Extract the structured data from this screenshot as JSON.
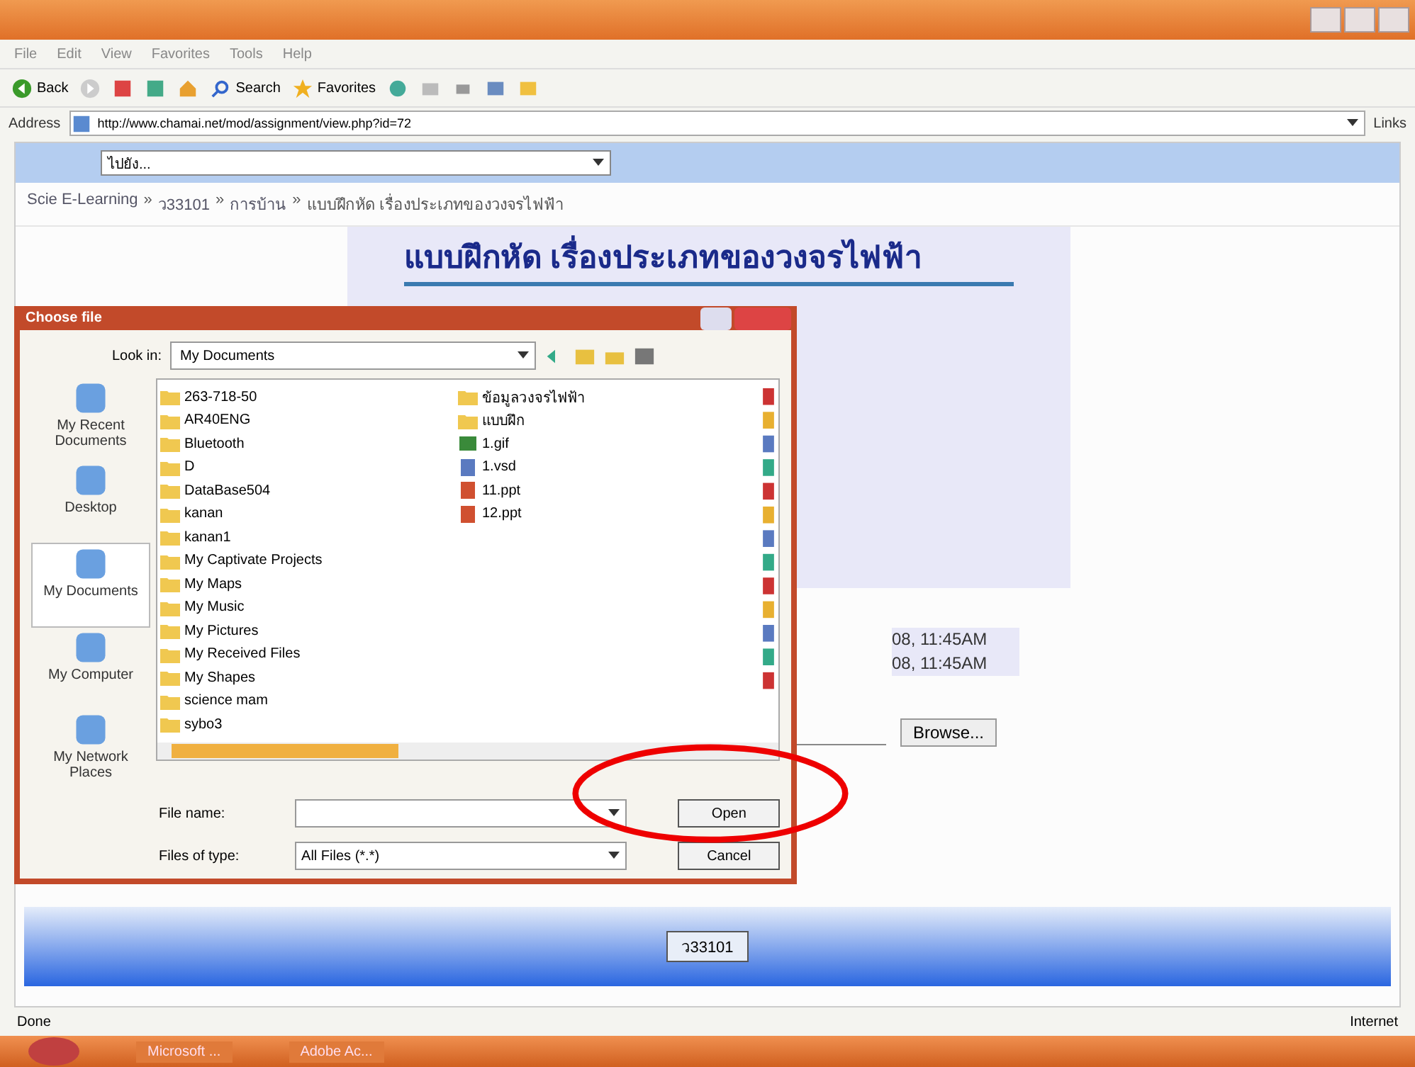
{
  "menu": [
    "File",
    "Edit",
    "View",
    "Favorites",
    "Tools",
    "Help"
  ],
  "toolbar": {
    "back": "Back",
    "search": "Search",
    "favorites": "Favorites"
  },
  "address": {
    "label": "Address",
    "url": "http://www.chamai.net/mod/assignment/view.php?id=72",
    "links": "Links"
  },
  "nav": {
    "jump": "ไปยัง..."
  },
  "breadcrumb": {
    "separator": "»",
    "items": [
      "Scie E-Learning",
      "ว33101",
      "การบ้าน",
      "แบบฝึกหัด เรื่องประเภทของวงจรไฟฟ้า"
    ]
  },
  "page": {
    "title": "แบบฝึกหัด เรื่องประเภทของวงจรไฟฟ้า",
    "dates": [
      "08, 11:45AM",
      "08, 11:45AM"
    ],
    "browse": "Browse..."
  },
  "footer": {
    "course_button": "ว33101"
  },
  "dialog": {
    "title": "Choose file",
    "look_in_label": "Look in:",
    "look_in": "My Documents",
    "places": [
      {
        "label": "My Recent Documents",
        "selected": false
      },
      {
        "label": "Desktop",
        "selected": false
      },
      {
        "label": "My Documents",
        "selected": true
      },
      {
        "label": "My Computer",
        "selected": false
      },
      {
        "label": "My Network Places",
        "selected": false
      }
    ],
    "files": [
      [
        {
          "name": "263-718-50",
          "kind": "folder"
        },
        {
          "name": "AR40ENG",
          "kind": "folder"
        },
        {
          "name": "Bluetooth",
          "kind": "folder"
        },
        {
          "name": "D",
          "kind": "folder"
        },
        {
          "name": "DataBase504",
          "kind": "folder"
        },
        {
          "name": "kanan",
          "kind": "folder"
        },
        {
          "name": "kanan1",
          "kind": "folder"
        },
        {
          "name": "My Captivate Projects",
          "kind": "folder"
        },
        {
          "name": "My Maps",
          "kind": "folder"
        },
        {
          "name": "My Music",
          "kind": "folder"
        },
        {
          "name": "My Pictures",
          "kind": "folder"
        },
        {
          "name": "My Received Files",
          "kind": "folder"
        },
        {
          "name": "My Shapes",
          "kind": "folder"
        },
        {
          "name": "science mam",
          "kind": "folder"
        },
        {
          "name": "sybo3",
          "kind": "folder"
        }
      ],
      [
        {
          "name": "ข้อมูลวงจรไฟฟ้า",
          "kind": "folder"
        },
        {
          "name": "แบบฝึก",
          "kind": "folder"
        },
        {
          "name": "1.gif",
          "kind": "image"
        },
        {
          "name": "1.vsd",
          "kind": "doc"
        },
        {
          "name": "11.ppt",
          "kind": "ppt"
        },
        {
          "name": "12.ppt",
          "kind": "ppt"
        }
      ]
    ],
    "file_name_label": "File name:",
    "file_type_label": "Files of type:",
    "file_type": "All Files (*.*)",
    "open": "Open",
    "cancel": "Cancel"
  },
  "status_bar": {
    "text": "Done",
    "zone": "Internet"
  },
  "taskbar": {
    "items": [
      "Microsoft ...",
      "Adobe Ac..."
    ]
  }
}
